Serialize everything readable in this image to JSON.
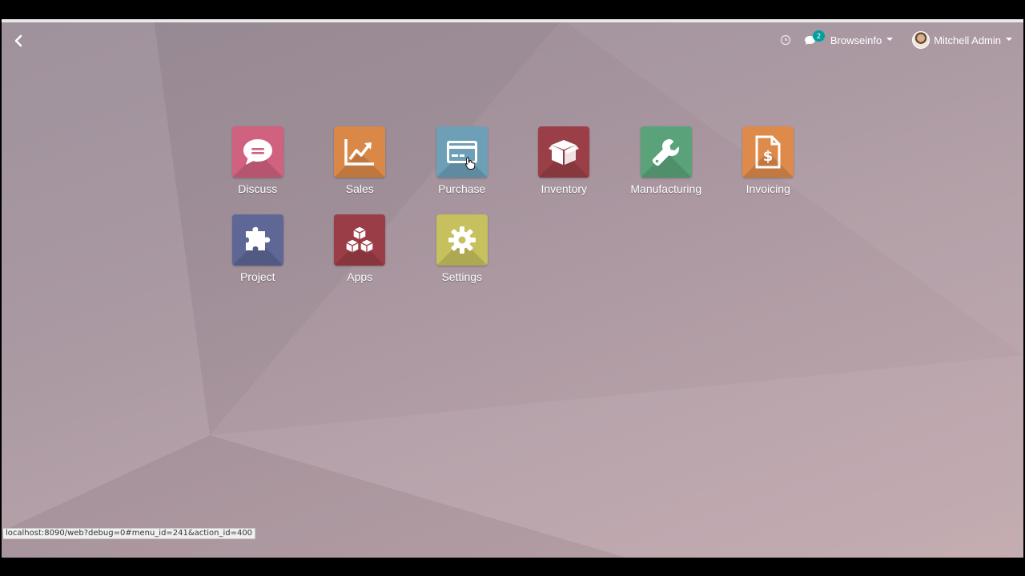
{
  "colors": {
    "discuss": "#d0617f",
    "sales": "#d98848",
    "purchase": "#6d9fb7",
    "inventory": "#9a3f47",
    "manufacturing": "#5aa37a",
    "invoicing": "#dd8a4b",
    "project": "#5e6796",
    "apps": "#9b3d46",
    "settings": "#c6c05f",
    "badge": "#00a09d"
  },
  "navbar": {
    "back_icon": "chevron-left-icon",
    "activity_icon": "clock-icon",
    "messaging_icon": "chat-icon",
    "messaging_count": "2",
    "company": "Browseinfo",
    "user": "Mitchell Admin"
  },
  "apps": [
    {
      "label": "Discuss",
      "icon": "chat-bubble-icon"
    },
    {
      "label": "Sales",
      "icon": "trend-chart-icon"
    },
    {
      "label": "Purchase",
      "icon": "credit-card-icon"
    },
    {
      "label": "Inventory",
      "icon": "box-icon"
    },
    {
      "label": "Manufacturing",
      "icon": "wrench-icon"
    },
    {
      "label": "Invoicing",
      "icon": "invoice-dollar-icon"
    },
    {
      "label": "Project",
      "icon": "puzzle-icon"
    },
    {
      "label": "Apps",
      "icon": "cubes-icon"
    },
    {
      "label": "Settings",
      "icon": "gear-icon"
    }
  ],
  "status_bar": {
    "url": "localhost:8090/web?debug=0#menu_id=241&action_id=400"
  }
}
